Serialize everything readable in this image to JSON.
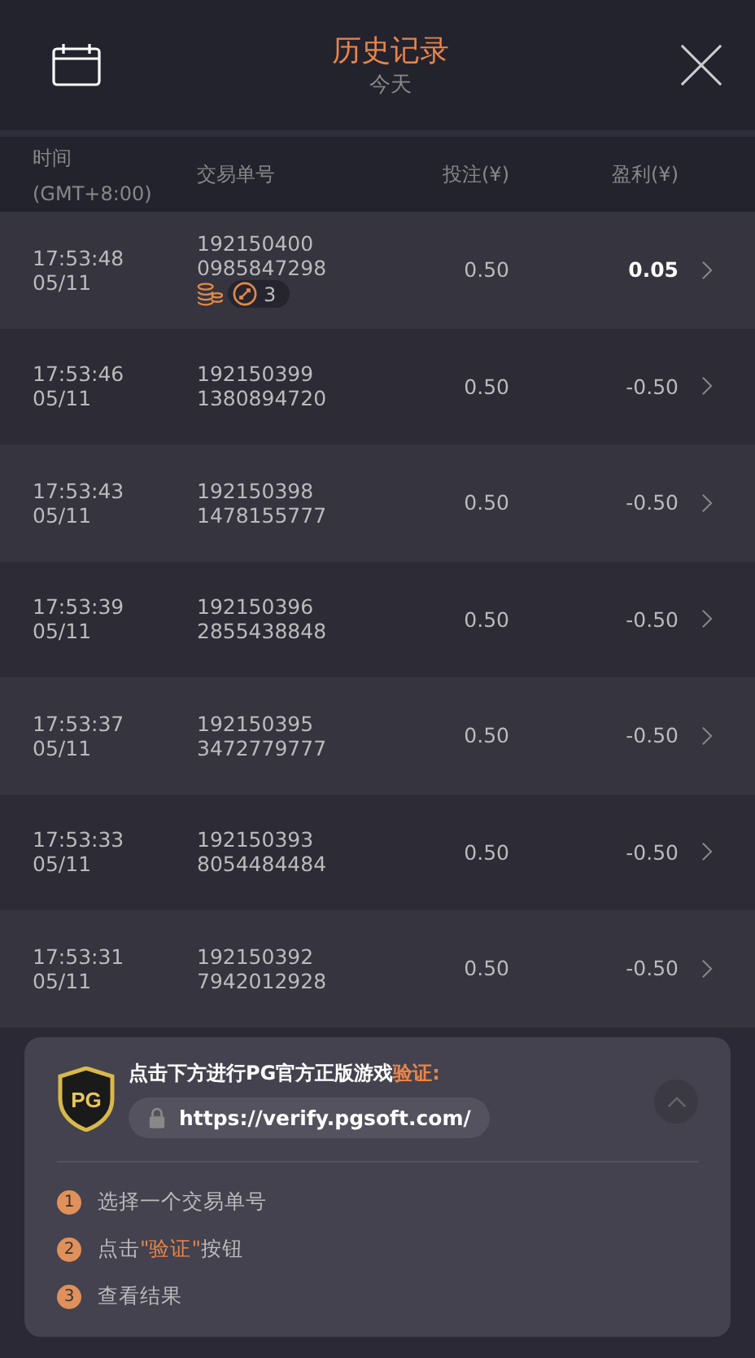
{
  "header": {
    "title": "历史记录",
    "subtitle": "今天"
  },
  "columns": [
    {
      "label": "时间",
      "sub": "(GMT+8:00)"
    },
    {
      "label": "交易单号"
    },
    {
      "label": "投注(¥)"
    },
    {
      "label": "盈利(¥)"
    }
  ],
  "rows": [
    {
      "time": "17:53:48",
      "date": "05/11",
      "id1": "192150400",
      "id2": "0985847298",
      "bet": "0.50",
      "profit": "0.05",
      "positive": true,
      "free_spins": "3"
    },
    {
      "time": "17:53:46",
      "date": "05/11",
      "id1": "192150399",
      "id2": "1380894720",
      "bet": "0.50",
      "profit": "-0.50",
      "positive": false
    },
    {
      "time": "17:53:43",
      "date": "05/11",
      "id1": "192150398",
      "id2": "1478155777",
      "bet": "0.50",
      "profit": "-0.50",
      "positive": false
    },
    {
      "time": "17:53:39",
      "date": "05/11",
      "id1": "192150396",
      "id2": "2855438848",
      "bet": "0.50",
      "profit": "-0.50",
      "positive": false
    },
    {
      "time": "17:53:37",
      "date": "05/11",
      "id1": "192150395",
      "id2": "3472779777",
      "bet": "0.50",
      "profit": "-0.50",
      "positive": false
    },
    {
      "time": "17:53:33",
      "date": "05/11",
      "id1": "192150393",
      "id2": "8054484484",
      "bet": "0.50",
      "profit": "-0.50",
      "positive": false
    },
    {
      "time": "17:53:31",
      "date": "05/11",
      "id1": "192150392",
      "id2": "7942012928",
      "bet": "0.50",
      "profit": "-0.50",
      "positive": false
    }
  ],
  "verify": {
    "logo_text": "PG",
    "prompt": [
      {
        "text": "点击下方进行PG官方正版游戏",
        "highlight": false
      },
      {
        "text": "验证:",
        "highlight": true
      }
    ],
    "url": "https://verify.pgsoft.com/",
    "steps": [
      {
        "number": "1",
        "parts": [
          {
            "text": "选择一个交易单号",
            "highlight": false
          }
        ]
      },
      {
        "number": "2",
        "parts": [
          {
            "text": "点击",
            "highlight": false
          },
          {
            "text": "\"验证\"",
            "highlight": true
          },
          {
            "text": "按钮",
            "highlight": false
          }
        ]
      },
      {
        "number": "3",
        "parts": [
          {
            "text": "查看结果",
            "highlight": false
          }
        ]
      }
    ]
  }
}
